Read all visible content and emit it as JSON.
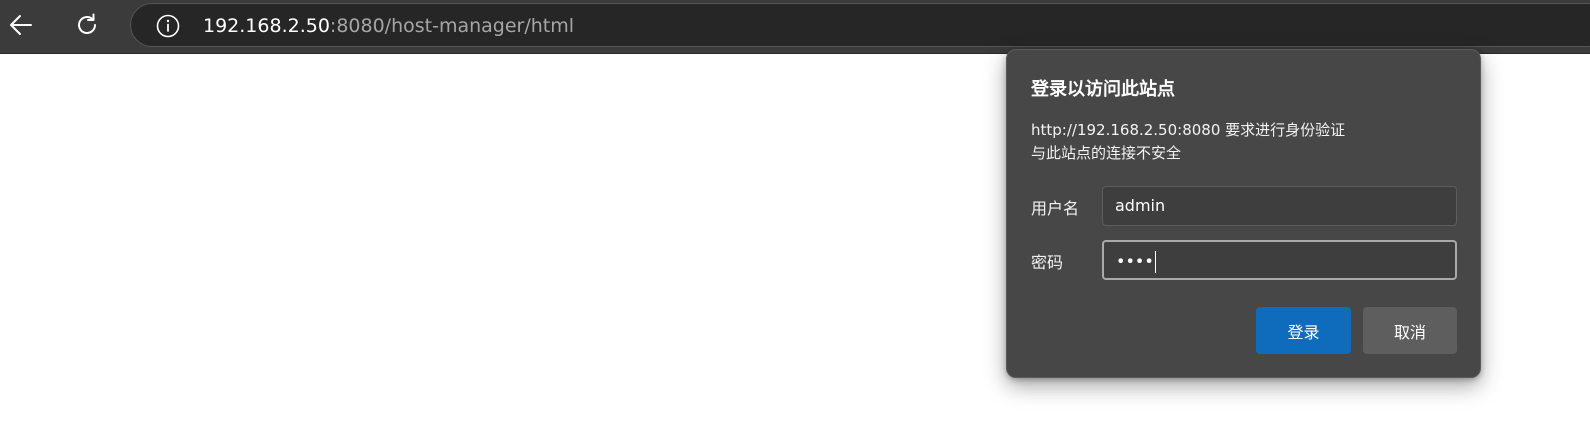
{
  "browser": {
    "url_host": "192.168.2.50",
    "url_rest": ":8080/host-manager/html",
    "icons": {
      "back": "back-arrow-icon",
      "reload": "reload-icon",
      "site_info": "info-icon"
    }
  },
  "dialog": {
    "title": "登录以访问此站点",
    "message_line1": "http://192.168.2.50:8080 要求进行身份验证",
    "message_line2": "与此站点的连接不安全",
    "username_label": "用户名",
    "username_value": "admin",
    "password_label": "密码",
    "password_mask": "••••",
    "login_label": "登录",
    "cancel_label": "取消"
  },
  "colors": {
    "toolbar": "#3b3b3b",
    "dialog_bg": "#474747",
    "primary_button": "#0f6cbd",
    "secondary_button": "#5e5e5e"
  }
}
